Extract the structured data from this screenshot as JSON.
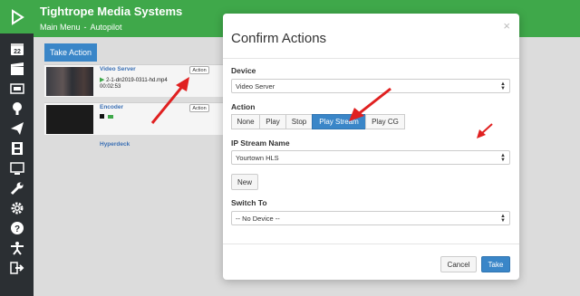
{
  "header": {
    "app_title": "Tightrope Media Systems",
    "breadcrumb": [
      "Main Menu",
      "Autopilot"
    ]
  },
  "sidebar": {
    "icons": [
      "play-logo-icon",
      "calendar-icon",
      "clapperboard-icon",
      "monitor-tv-icon",
      "podcast-icon",
      "paper-plane-icon",
      "film-icon",
      "display-icon",
      "wrench-icon",
      "gear-icon",
      "help-icon",
      "accessibility-icon",
      "sign-out-icon"
    ],
    "calendar_day": "22"
  },
  "main": {
    "take_action_label": "Take Action",
    "devices": [
      {
        "name": "Video Server",
        "file": "2-1-dn2019-0311-hd.mp4",
        "duration": "00:02:53",
        "action_label": "Action"
      },
      {
        "name": "Encoder",
        "action_label": "Action"
      },
      {
        "name": "Hyperdeck"
      }
    ]
  },
  "modal": {
    "title": "Confirm Actions",
    "close_glyph": "×",
    "device_label": "Device",
    "device_value": "Video Server",
    "action_label": "Action",
    "actions": [
      "None",
      "Play",
      "Stop",
      "Play Stream",
      "Play CG"
    ],
    "active_action": "Play Stream",
    "ip_stream_label": "IP Stream Name",
    "ip_stream_value": "Yourtown HLS",
    "new_label": "New",
    "switch_to_label": "Switch To",
    "switch_to_value": "-- No Device --",
    "cancel_label": "Cancel",
    "take_label": "Take"
  },
  "colors": {
    "brand_green": "#3fa84a",
    "primary_blue": "#3a86c8",
    "sidebar_dark": "#2b2f33",
    "annotation_red": "#e02020"
  }
}
